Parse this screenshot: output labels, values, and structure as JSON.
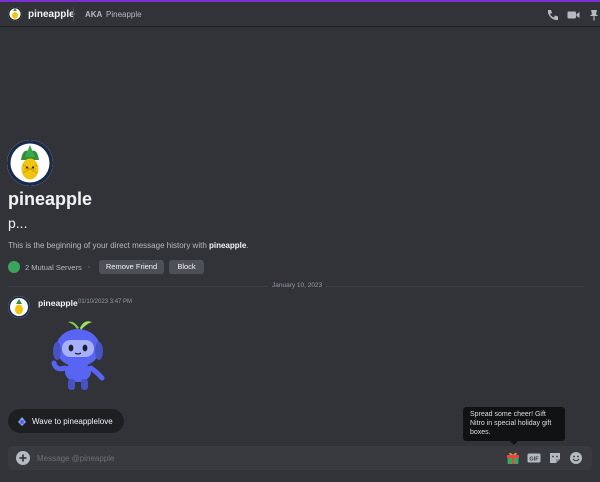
{
  "header": {
    "name": "pineapple",
    "aka_label": "AKA",
    "aka_value": "Pineapple"
  },
  "welcome": {
    "name": "pineapple",
    "subtitle": "p...",
    "desc_prefix": "This is the beginning of your direct message history with ",
    "desc_name": "pineapple",
    "desc_suffix": ".",
    "mutual": "2 Mutual Servers",
    "remove_friend": "Remove Friend",
    "block": "Block"
  },
  "divider": {
    "date": "January 10, 2023"
  },
  "message": {
    "author": "pineapple",
    "timestamp": "01/10/2023 3:47 PM"
  },
  "wave": {
    "label": "Wave to pineapplelove"
  },
  "tooltip": {
    "text": "Spread some cheer! Gift Nitro in special holiday gift boxes."
  },
  "composer": {
    "placeholder": "Message @pineapple"
  },
  "colors": {
    "accent": "#5865f2",
    "background": "#313338",
    "topbar": "#7b2fd0"
  }
}
